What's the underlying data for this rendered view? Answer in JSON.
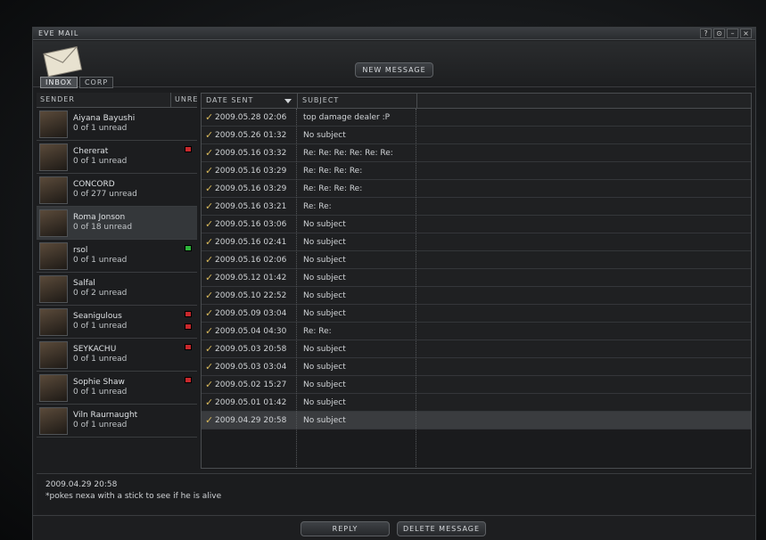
{
  "window": {
    "title": "EVE MAIL",
    "controls": [
      "?",
      "⊙",
      "–",
      "×"
    ]
  },
  "header": {
    "new_message_label": "NEW MESSAGE",
    "tabs": [
      {
        "label": "INBOX",
        "active": true
      },
      {
        "label": "CORP",
        "active": false
      }
    ]
  },
  "senders": {
    "columns": {
      "sender": "SENDER",
      "unread": "UNREAD"
    },
    "items": [
      {
        "name": "Aiyana Bayushi",
        "unread": "0 of 1 unread",
        "badges": []
      },
      {
        "name": "Chererat",
        "unread": "0 of 1 unread",
        "badges": [
          "red"
        ]
      },
      {
        "name": "CONCORD",
        "unread": "0 of 277 unread",
        "badges": []
      },
      {
        "name": "Roma Jonson",
        "unread": "0 of 18 unread",
        "badges": [],
        "selected": true
      },
      {
        "name": "rsol",
        "unread": "0 of 1 unread",
        "badges": [
          "green"
        ]
      },
      {
        "name": "Salfal",
        "unread": "0 of 2 unread",
        "badges": []
      },
      {
        "name": "Seanigulous",
        "unread": "0 of 1 unread",
        "badges": [
          "red",
          "red"
        ]
      },
      {
        "name": "SEYKACHU",
        "unread": "0 of 1 unread",
        "badges": [
          "red"
        ]
      },
      {
        "name": "Sophie Shaw",
        "unread": "0 of 1 unread",
        "badges": [
          "red"
        ]
      },
      {
        "name": "Viln Raurnaught",
        "unread": "0 of 1 unread",
        "badges": []
      }
    ]
  },
  "messages": {
    "columns": {
      "date": "DATE SENT",
      "subject": "SUBJECT"
    },
    "rows": [
      {
        "date": "2009.05.28  02:06",
        "subject": "top damage dealer :P"
      },
      {
        "date": "2009.05.26  01:32",
        "subject": "No subject"
      },
      {
        "date": "2009.05.16  03:32",
        "subject": "Re: Re: Re: Re: Re: Re:"
      },
      {
        "date": "2009.05.16  03:29",
        "subject": "Re: Re: Re: Re:"
      },
      {
        "date": "2009.05.16  03:29",
        "subject": "Re: Re: Re: Re:"
      },
      {
        "date": "2009.05.16  03:21",
        "subject": "Re: Re:"
      },
      {
        "date": "2009.05.16  03:06",
        "subject": "No subject"
      },
      {
        "date": "2009.05.16  02:41",
        "subject": "No subject"
      },
      {
        "date": "2009.05.16  02:06",
        "subject": "No subject"
      },
      {
        "date": "2009.05.12  01:42",
        "subject": "No subject"
      },
      {
        "date": "2009.05.10  22:52",
        "subject": "No subject"
      },
      {
        "date": "2009.05.09  03:04",
        "subject": "No subject"
      },
      {
        "date": "2009.05.04  04:30",
        "subject": "Re: Re:"
      },
      {
        "date": "2009.05.03  20:58",
        "subject": "No subject"
      },
      {
        "date": "2009.05.03  03:04",
        "subject": "No subject"
      },
      {
        "date": "2009.05.02  15:27",
        "subject": "No subject"
      },
      {
        "date": "2009.05.01  01:42",
        "subject": "No subject"
      },
      {
        "date": "2009.04.29  20:58",
        "subject": "No subject",
        "selected": true
      }
    ]
  },
  "preview": {
    "date": "2009.04.29  20:58",
    "body": "*pokes nexa with a stick to see if he is alive"
  },
  "footer": {
    "reply_label": "REPLY",
    "delete_label": "DELETE MESSAGE"
  },
  "colors": {
    "badge_red": "#c8282c",
    "badge_green": "#2eb53a",
    "check": "#d9b95a"
  }
}
